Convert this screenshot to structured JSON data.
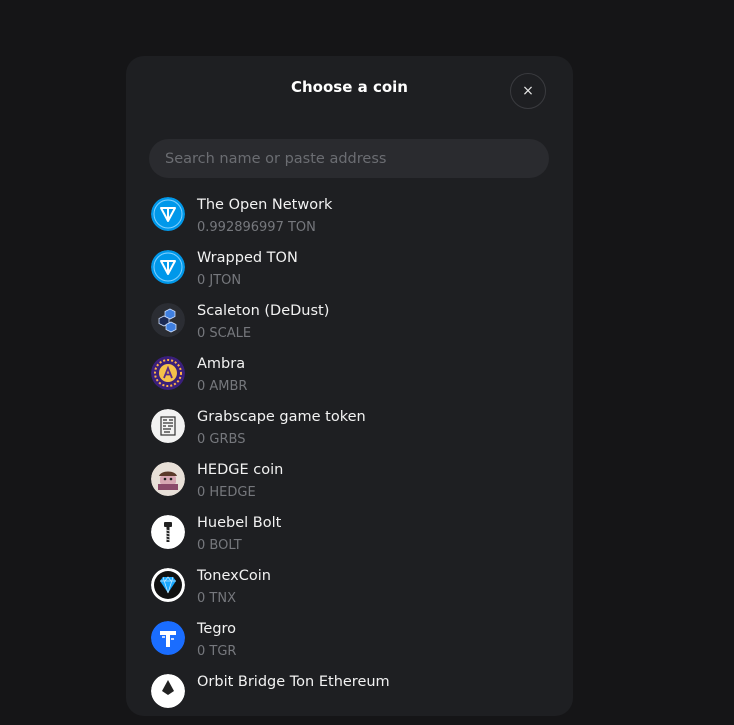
{
  "modal": {
    "title": "Choose a coin",
    "close_label": "×",
    "search_placeholder": "Search name or paste address"
  },
  "coins": [
    {
      "name": "The Open Network",
      "balance": "0.992896997 TON",
      "icon": "ton-icon"
    },
    {
      "name": "Wrapped TON",
      "balance": "0 JTON",
      "icon": "wrapped-ton-icon"
    },
    {
      "name": "Scaleton (DeDust)",
      "balance": "0 SCALE",
      "icon": "scaleton-icon"
    },
    {
      "name": "Ambra",
      "balance": "0 AMBR",
      "icon": "ambra-icon"
    },
    {
      "name": "Grabscape game token",
      "balance": "0 GRBS",
      "icon": "grabscape-icon"
    },
    {
      "name": "HEDGE coin",
      "balance": "0 HEDGE",
      "icon": "hedge-icon"
    },
    {
      "name": "Huebel Bolt",
      "balance": "0 BOLT",
      "icon": "bolt-icon"
    },
    {
      "name": "TonexCoin",
      "balance": "0 TNX",
      "icon": "tonex-icon"
    },
    {
      "name": "Tegro",
      "balance": "0 TGR",
      "icon": "tegro-icon"
    },
    {
      "name": "Orbit Bridge Ton Ethereum",
      "balance": "",
      "icon": "orbit-bridge-icon"
    }
  ],
  "colors": {
    "background": "#151517",
    "modal": "#1e1f22",
    "search": "#2a2b2f",
    "ton_blue": "#0098ea",
    "muted_text": "#76787d"
  }
}
